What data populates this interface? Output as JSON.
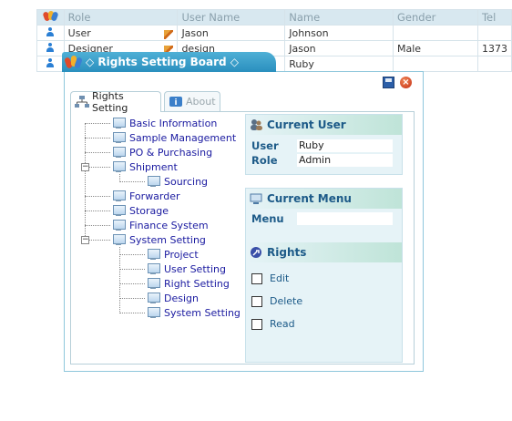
{
  "grid": {
    "columns": [
      "Role",
      "User Name",
      "Name",
      "Gender",
      "Tel"
    ],
    "rows": [
      {
        "role": "User",
        "username": "Jason",
        "name": "Johnson",
        "gender": "",
        "tel": ""
      },
      {
        "role": "Designer",
        "username": "design",
        "name": "Jason",
        "gender": "Male",
        "tel": "1373"
      },
      {
        "role": "",
        "username": "",
        "name": "Ruby",
        "gender": "",
        "tel": ""
      }
    ]
  },
  "dialog": {
    "title": "◇ Rights Setting Board ◇",
    "tabs": [
      {
        "label": "Rights Setting",
        "active": true
      },
      {
        "label": "About",
        "active": false
      }
    ]
  },
  "tree": {
    "nodes": [
      {
        "label": "Basic Information"
      },
      {
        "label": "Sample Management"
      },
      {
        "label": "PO & Purchasing"
      },
      {
        "label": "Shipment",
        "expanded": true
      },
      {
        "label": "Sourcing",
        "child": true
      },
      {
        "label": "Forwarder"
      },
      {
        "label": "Storage"
      },
      {
        "label": "Finance System"
      },
      {
        "label": "System Setting",
        "expanded": true
      },
      {
        "label": "Project",
        "child": true
      },
      {
        "label": "User Setting",
        "child": true
      },
      {
        "label": "Right Setting",
        "child": true
      },
      {
        "label": "Design",
        "child": true
      },
      {
        "label": "System Setting",
        "child": true
      }
    ]
  },
  "current_user": {
    "title": "Current User",
    "user_label": "User",
    "user_value": "Ruby",
    "role_label": "Role",
    "role_value": "Admin"
  },
  "current_menu": {
    "title": "Current Menu",
    "menu_label": "Menu",
    "menu_value": ""
  },
  "rights": {
    "title": "Rights",
    "items": [
      {
        "label": "Edit",
        "checked": false
      },
      {
        "label": "Delete",
        "checked": false
      },
      {
        "label": "Read",
        "checked": false
      }
    ]
  },
  "colors": {
    "accent": "#2a8fbe",
    "panel_bg": "#e6f3f7",
    "tree_text": "#1a1aa0",
    "panel_title": "#1c5a88"
  }
}
